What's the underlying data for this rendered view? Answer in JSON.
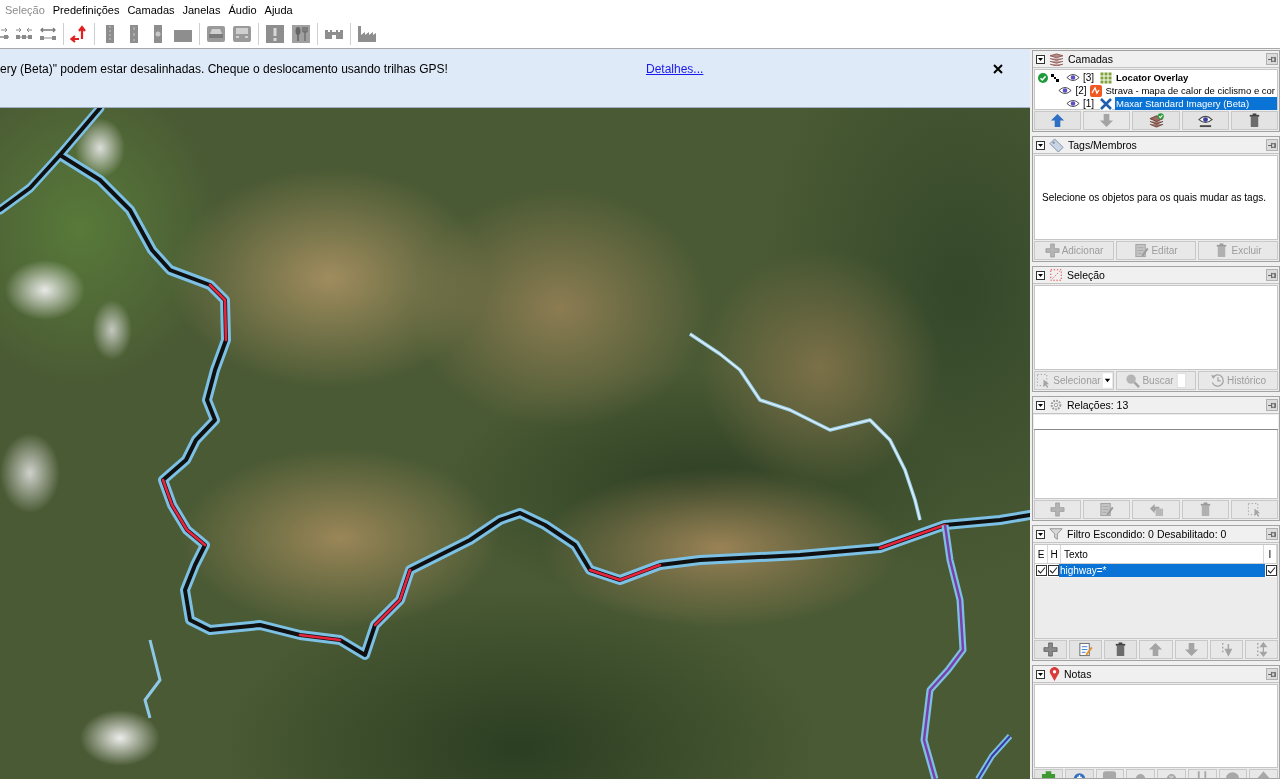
{
  "menu_bar": {
    "items": [
      {
        "label": "Seleção",
        "disabled": true
      },
      {
        "label": "Predefinições",
        "disabled": false
      },
      {
        "label": "Camadas",
        "disabled": false
      },
      {
        "label": "Janelas",
        "disabled": false
      },
      {
        "label": "Áudio",
        "disabled": false
      },
      {
        "label": "Ajuda",
        "disabled": false
      }
    ]
  },
  "notification": {
    "message": "ery (Beta)\" podem estar desalinhadas. Cheque o deslocamento usando trilhas GPS!",
    "link": "Detalhes..."
  },
  "layers_panel": {
    "title": "Camadas",
    "layers": [
      {
        "index": "[3]",
        "name": "Locator Overlay",
        "kind": "grid",
        "active": true,
        "native_scale": true,
        "visible": true,
        "selected": false
      },
      {
        "index": "[2]",
        "name": "Strava - mapa de calor de ciclismo e cor",
        "kind": "heatmap",
        "active": false,
        "native_scale": false,
        "visible": true,
        "selected": false
      },
      {
        "index": "[1]",
        "name": "Maxar Standard Imagery (Beta)",
        "kind": "imagery",
        "active": false,
        "native_scale": false,
        "visible": true,
        "selected": true
      }
    ],
    "buttons": [
      {
        "kind": "move-up",
        "disabled": false
      },
      {
        "kind": "move-down",
        "disabled": true
      },
      {
        "kind": "activate",
        "disabled": false
      },
      {
        "kind": "visibility",
        "disabled": false
      },
      {
        "kind": "delete",
        "disabled": false
      }
    ]
  },
  "tags_panel": {
    "title": "Tags/Membros",
    "message": "Selecione os objetos para os quais mudar as tags.",
    "buttons": [
      {
        "kind": "add",
        "label": "Adicionar",
        "disabled": true
      },
      {
        "kind": "edit",
        "label": "Editar",
        "disabled": true
      },
      {
        "kind": "delete",
        "label": "Excluir",
        "disabled": true
      }
    ]
  },
  "selection_panel": {
    "title": "Seleção",
    "buttons": [
      {
        "kind": "select",
        "label": "Selecionar",
        "disabled": true
      },
      {
        "kind": "search",
        "label": "Buscar",
        "disabled": true
      },
      {
        "kind": "history",
        "label": "Histórico",
        "disabled": true
      }
    ]
  },
  "relations_panel": {
    "title": "Relações: 13",
    "buttons": [
      {
        "kind": "add",
        "disabled": true
      },
      {
        "kind": "edit",
        "disabled": true
      },
      {
        "kind": "duplicate",
        "disabled": true
      },
      {
        "kind": "delete",
        "disabled": true
      },
      {
        "kind": "select",
        "disabled": true
      }
    ]
  },
  "filter_panel": {
    "title": "Filtro Escondido: 0 Desabilitado: 0",
    "columns": [
      "E",
      "H",
      "Texto",
      "I"
    ],
    "rows": [
      {
        "enabled": true,
        "hiding": true,
        "text": "highway=*",
        "inverted": true,
        "selected": true
      }
    ],
    "buttons": [
      {
        "kind": "add",
        "disabled": false
      },
      {
        "kind": "edit",
        "disabled": false
      },
      {
        "kind": "delete",
        "disabled": false
      },
      {
        "kind": "move-up",
        "disabled": true
      },
      {
        "kind": "move-down",
        "disabled": true
      },
      {
        "kind": "sort-down",
        "disabled": true
      },
      {
        "kind": "sort-up",
        "disabled": true
      }
    ]
  },
  "notes_panel": {
    "title": "Notas",
    "buttons": [
      {
        "kind": "download",
        "disabled": false
      },
      {
        "kind": "new",
        "disabled": false
      },
      {
        "kind": "comment",
        "disabled": true
      },
      {
        "kind": "resolve",
        "disabled": true
      },
      {
        "kind": "reopen",
        "disabled": true
      },
      {
        "kind": "sort",
        "disabled": true
      },
      {
        "kind": "lookup",
        "disabled": true
      },
      {
        "kind": "upload",
        "disabled": true
      }
    ]
  }
}
